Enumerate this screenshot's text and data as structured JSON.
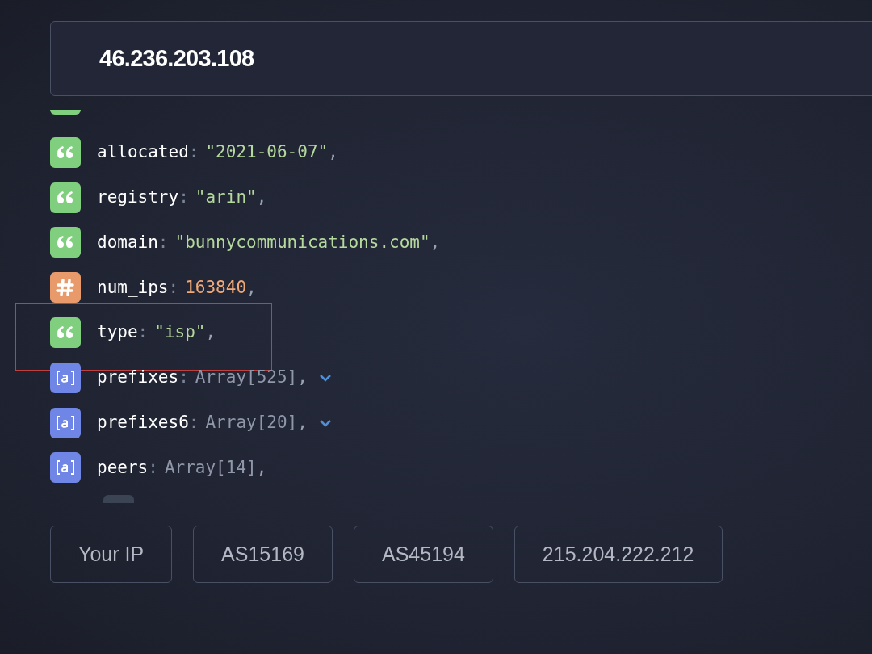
{
  "search": {
    "value": "46.236.203.108"
  },
  "fields": [
    {
      "kind": "string",
      "key": "allocated",
      "colon": ":",
      "value": "\"2021-06-07\"",
      "comma": ",",
      "expandable": false,
      "highlighted": false
    },
    {
      "kind": "string",
      "key": "registry",
      "colon": ":",
      "value": "\"arin\"",
      "comma": ",",
      "expandable": false,
      "highlighted": false
    },
    {
      "kind": "string",
      "key": "domain",
      "colon": ":",
      "value": "\"bunnycommunications.com\"",
      "comma": ",",
      "expandable": false,
      "highlighted": false
    },
    {
      "kind": "number",
      "key": "num_ips",
      "colon": ":",
      "value": "163840",
      "comma": ",",
      "expandable": false,
      "highlighted": false
    },
    {
      "kind": "string",
      "key": "type",
      "colon": ":",
      "value": "\"isp\"",
      "comma": ",",
      "expandable": false,
      "highlighted": true
    },
    {
      "kind": "array",
      "key": "prefixes",
      "colon": ":",
      "value": "Array[525]",
      "comma": ",",
      "expandable": true,
      "highlighted": false
    },
    {
      "kind": "array",
      "key": "prefixes6",
      "colon": ":",
      "value": "Array[20]",
      "comma": ",",
      "expandable": true,
      "highlighted": false
    },
    {
      "kind": "array",
      "key": "peers",
      "colon": ":",
      "value": "Array[14]",
      "comma": ",",
      "expandable": false,
      "highlighted": false
    }
  ],
  "quick_links": [
    "Your IP",
    "AS15169",
    "AS45194",
    "215.204.222.212"
  ]
}
